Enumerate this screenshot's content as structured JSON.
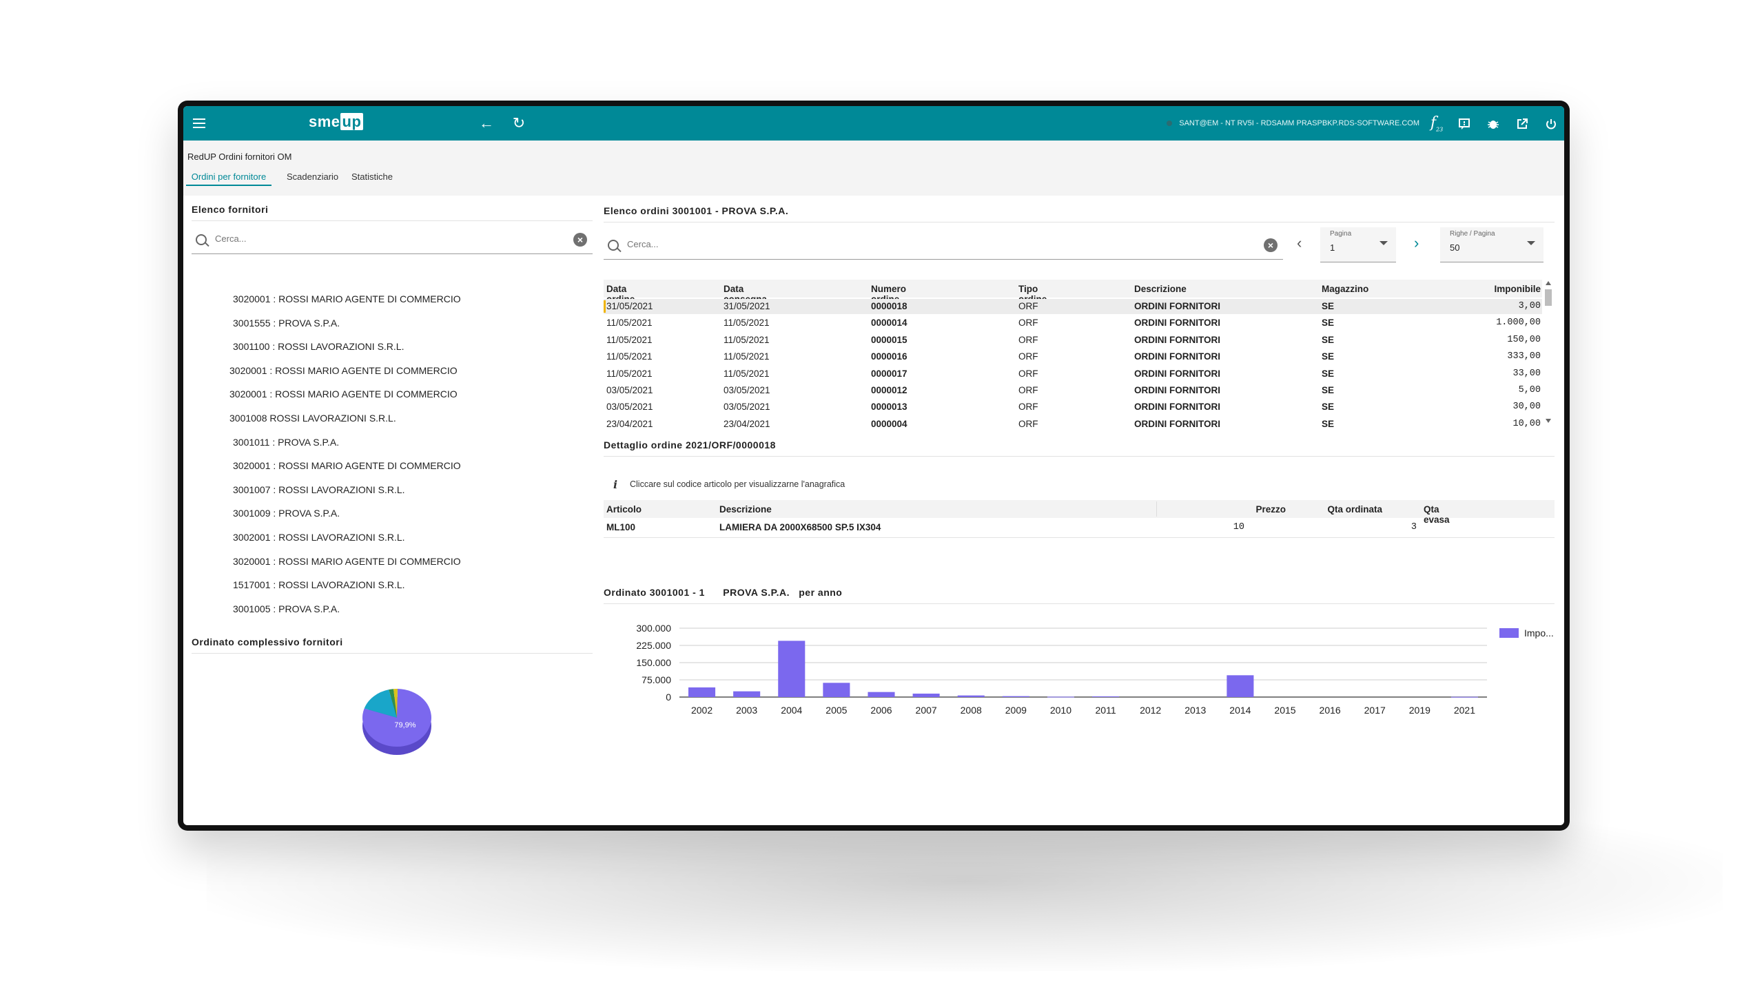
{
  "header": {
    "logo_left": "sme",
    "logo_right": "up",
    "user_info": "SANT@EM - NT RV5I - RDSAMM PRASPBKP.RDS-SOFTWARE.COM",
    "fx_label": "f",
    "fx_sub": "23"
  },
  "app": {
    "title": "RedUP Ordini fornitori OM",
    "tabs": [
      "Ordini per fornitore",
      "Scadenziario",
      "Statistiche"
    ]
  },
  "left": {
    "title": "Elenco fornitori",
    "search_placeholder": "Cerca...",
    "suppliers": [
      "3020001 : ROSSI MARIO AGENTE DI COMMERCIO",
      "3001555 : PROVA S.P.A.",
      "3001100 : ROSSI LAVORAZIONI S.R.L.",
      "3020001 : ROSSI MARIO AGENTE DI COMMERCIO",
      "3020001 : ROSSI MARIO AGENTE DI COMMERCIO",
      "3001008 ROSSI LAVORAZIONI S.R.L.",
      "3001011 : PROVA S.P.A.",
      "3020001 : ROSSI MARIO AGENTE DI COMMERCIO",
      "3001007 : ROSSI LAVORAZIONI S.R.L.",
      "3001009 : PROVA S.P.A.",
      "3002001 : ROSSI LAVORAZIONI S.R.L.",
      "3020001 : ROSSI MARIO AGENTE DI COMMERCIO",
      "1517001 : ROSSI LAVORAZIONI S.R.L.",
      "3001005 : PROVA S.P.A."
    ],
    "pie_title": "Ordinato complessivo fornitori",
    "pie_label": "79,9%",
    "pie_slices": [
      {
        "value": 79.9,
        "color": "#7b68ee"
      },
      {
        "value": 16.0,
        "color": "#19a6c9"
      },
      {
        "value": 2.2,
        "color": "#2f8f4e"
      },
      {
        "value": 1.9,
        "color": "#d9c21a"
      }
    ]
  },
  "orders": {
    "title": "Elenco ordini 3001001 -  PROVA S.P.A.",
    "search_placeholder": "Cerca...",
    "page_label": "Pagina",
    "page_value": "1",
    "rows_label": "Righe / Pagina",
    "rows_value": "50",
    "columns": [
      "Data ordine",
      "Data consegna",
      "Numero ordine",
      "Tipo ordine",
      "Descrizione",
      "Magazzino",
      "Imponibile"
    ],
    "rows": [
      [
        "31/05/2021",
        "31/05/2021",
        "0000018",
        "ORF",
        "ORDINI FORNITORI",
        "SE",
        "3,00"
      ],
      [
        "11/05/2021",
        "11/05/2021",
        "0000014",
        "ORF",
        "ORDINI FORNITORI",
        "SE",
        "1.000,00"
      ],
      [
        "11/05/2021",
        "11/05/2021",
        "0000015",
        "ORF",
        "ORDINI FORNITORI",
        "SE",
        "150,00"
      ],
      [
        "11/05/2021",
        "11/05/2021",
        "0000016",
        "ORF",
        "ORDINI FORNITORI",
        "SE",
        "333,00"
      ],
      [
        "11/05/2021",
        "11/05/2021",
        "0000017",
        "ORF",
        "ORDINI FORNITORI",
        "SE",
        "33,00"
      ],
      [
        "03/05/2021",
        "03/05/2021",
        "0000012",
        "ORF",
        "ORDINI FORNITORI",
        "SE",
        "5,00"
      ],
      [
        "03/05/2021",
        "03/05/2021",
        "0000013",
        "ORF",
        "ORDINI FORNITORI",
        "SE",
        "30,00"
      ],
      [
        "23/04/2021",
        "23/04/2021",
        "0000004",
        "ORF",
        "ORDINI FORNITORI",
        "SE",
        "10,00"
      ]
    ]
  },
  "detail": {
    "title": "Dettaglio ordine 2021/ORF/0000018",
    "info_icon": "i",
    "info_text": "Cliccare sul codice articolo per visualizzarne l'anagrafica",
    "columns": [
      "Articolo",
      "Descrizione",
      "Prezzo",
      "Qta ordinata",
      "Qta evasa"
    ],
    "rows": [
      [
        "ML100",
        "LAMIERA DA 2000X68500 SP.5 IX304",
        "10",
        "3",
        ""
      ]
    ]
  },
  "chart_title": "Ordinato 3001001 - 1      PROVA S.P.A.   per anno",
  "chart_data": {
    "type": "bar",
    "categories": [
      "2002",
      "2003",
      "2004",
      "2005",
      "2006",
      "2007",
      "2008",
      "2009",
      "2010",
      "2011",
      "2012",
      "2013",
      "2014",
      "2015",
      "2016",
      "2017",
      "2019",
      "2021"
    ],
    "series": [
      {
        "name": "Impo...",
        "values": [
          42000,
          25000,
          245000,
          62000,
          22000,
          15000,
          7000,
          4000,
          1500,
          3000,
          0,
          0,
          95000,
          0,
          0,
          0,
          0,
          1000
        ],
        "color": "#7b68ee"
      }
    ],
    "yticks": [
      "0",
      "75.000",
      "150.000",
      "225.000",
      "300.000"
    ],
    "ylim": [
      0,
      300000
    ],
    "legend_position": "top-right"
  }
}
